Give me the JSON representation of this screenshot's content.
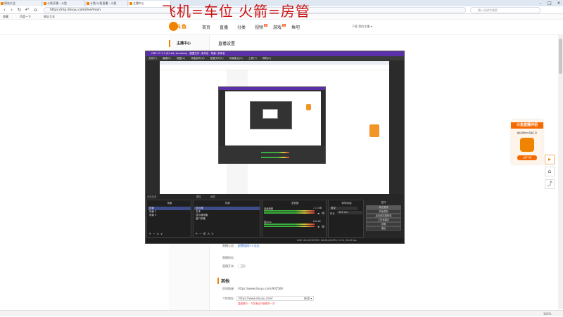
{
  "browser": {
    "tabs": [
      {
        "label": "网站大全"
      },
      {
        "label": "斗鱼开播 - 斗鱼"
      },
      {
        "label": "斗鱼/斗鱼直播 - 斗鱼"
      },
      {
        "label": "主播中心"
      }
    ],
    "url": "https://mp.douyu.com/live/main",
    "search_placeholder": "输入关键字搜索",
    "bookmarks": [
      "收藏",
      "百度一下",
      "网址大全"
    ]
  },
  "banner": "飞机=车位  火箭=房管",
  "site": {
    "logo_text": "斗鱼",
    "nav": [
      {
        "label": "首页"
      },
      {
        "label": "直播"
      },
      {
        "label": "分类"
      },
      {
        "label": "视频",
        "badge": "新"
      },
      {
        "label": "游戏",
        "badge": "热"
      },
      {
        "label": "鱼吧"
      }
    ],
    "user_text": "下载   我的主播 ▾"
  },
  "sidebar": {
    "title": "主播中心"
  },
  "content": {
    "title": "直播设置",
    "fields": [
      {
        "label": "直播公告:",
        "value": "配置链接>>点击"
      },
      {
        "label": "直播地址:",
        "value": "已开启"
      },
      {
        "label": "直播开关:",
        "value": ""
      }
    ],
    "section_other": "其他",
    "room_url_label": "房间链接:",
    "room_url": "https://www.douyu.com/905568",
    "custom_addr_label": "个性地址:",
    "custom_addr_value": "https://www.douyu.com/",
    "custom_addr_btn": "修改 ▾",
    "custom_addr_note": "温馨提示：个性地址只能修改一次"
  },
  "promo": {
    "title": "斗鱼直播伴侣",
    "subtitle": "超好用的PC直播工具",
    "button": "立即下载"
  },
  "obs": {
    "title": "OBS 27.1.3 (64-bit, windows) - 配置文件: 未命名 - 场景: 未命名",
    "menu": [
      "文件(F)",
      "编辑(E)",
      "视图(V)",
      "停靠部件(D)",
      "配置文件(P)",
      "场景集合(S)",
      "工具(T)",
      "帮助(H)"
    ],
    "source_bar": [
      "未选择源",
      "属性",
      "滤镜"
    ],
    "docks": {
      "scenes": {
        "title": "场景",
        "items": [
          "场景",
          "场景 2",
          "场景 3"
        ]
      },
      "sources": {
        "title": "来源",
        "items": [
          "显示器",
          "文本",
          "显示器采集",
          "窗口采集"
        ]
      },
      "mixer": {
        "title": "混音器",
        "channels": [
          {
            "name": "桌面音频",
            "db": "-7.3 dB"
          },
          {
            "name": "麦/Aux",
            "db": "0.0 dB"
          }
        ]
      },
      "transitions": {
        "title": "转场动画",
        "type": "渐变",
        "duration_label": "时长",
        "duration": "300 ms"
      },
      "controls": {
        "title": "控件",
        "buttons": [
          "停止推流",
          "开始录制",
          "启动虚拟摄像机",
          "工作室模式",
          "设置",
          "退出"
        ]
      }
    },
    "status": "LIVE: 00:05:35   REC: 00:00:00   CPU: 5.1%, 30.00 fps"
  },
  "statusbar": {
    "zoom": "100%"
  }
}
